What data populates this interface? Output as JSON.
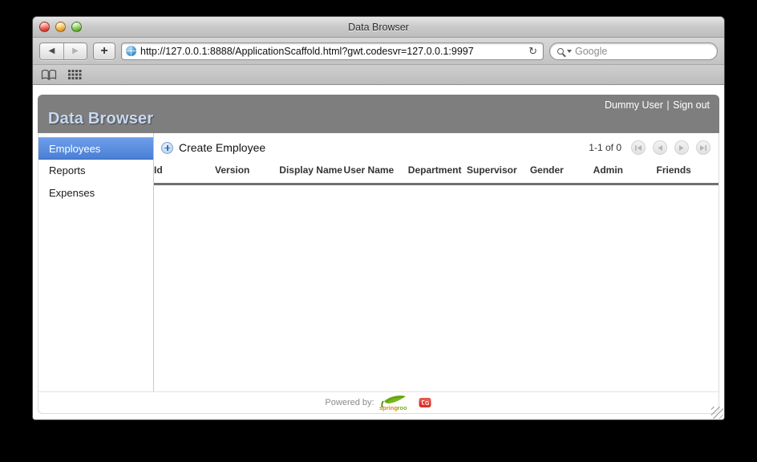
{
  "window": {
    "title": "Data Browser",
    "controls": {
      "close": "close",
      "minimize": "minimize",
      "zoom": "zoom"
    }
  },
  "browser_toolbar": {
    "back_label": "◀",
    "forward_label": "▶",
    "new_tab_label": "+",
    "url": "http://127.0.0.1:8888/ApplicationScaffold.html?gwt.codesvr=127.0.0.1:9997",
    "reload_label": "↻",
    "search_placeholder": "Google",
    "search_value": ""
  },
  "bookmarks_bar": {
    "items": [
      {
        "icon": "book-icon",
        "label": ""
      },
      {
        "icon": "grid-icon",
        "label": ""
      }
    ]
  },
  "app": {
    "header": {
      "title": "Data Browser",
      "user_name": "Dummy User",
      "separator": "|",
      "sign_out_label": "Sign out"
    },
    "sidebar": {
      "items": [
        {
          "label": "Employees",
          "selected": true
        },
        {
          "label": "Reports",
          "selected": false
        },
        {
          "label": "Expenses",
          "selected": false
        }
      ]
    },
    "list_toolbar": {
      "create_label": "Create Employee",
      "create_icon": "plus-circle-icon"
    },
    "pager": {
      "range_label": "1-1 of 0",
      "first_icon": "first-page-icon",
      "prev_icon": "prev-page-icon",
      "next_icon": "next-page-icon",
      "last_icon": "last-page-icon"
    },
    "table": {
      "columns": [
        "Id",
        "Version",
        "Display Name",
        "User Name",
        "Department",
        "Supervisor",
        "Gender",
        "Admin",
        "Friends"
      ],
      "rows": []
    },
    "footer": {
      "powered_by_label": "Powered by:",
      "logos": [
        {
          "name": "spring-roo-logo",
          "text": "spring roo"
        },
        {
          "name": "gwt-logo",
          "text": "G"
        }
      ]
    }
  },
  "colors": {
    "app_header_bg": "#7e7e7e",
    "app_title_text": "#c8d9f2",
    "nav_selected_bg": "#4a7fd4",
    "table_header_rule": "#707070",
    "roo_green": "#7ab317",
    "gwt_red": "#d9332b"
  }
}
